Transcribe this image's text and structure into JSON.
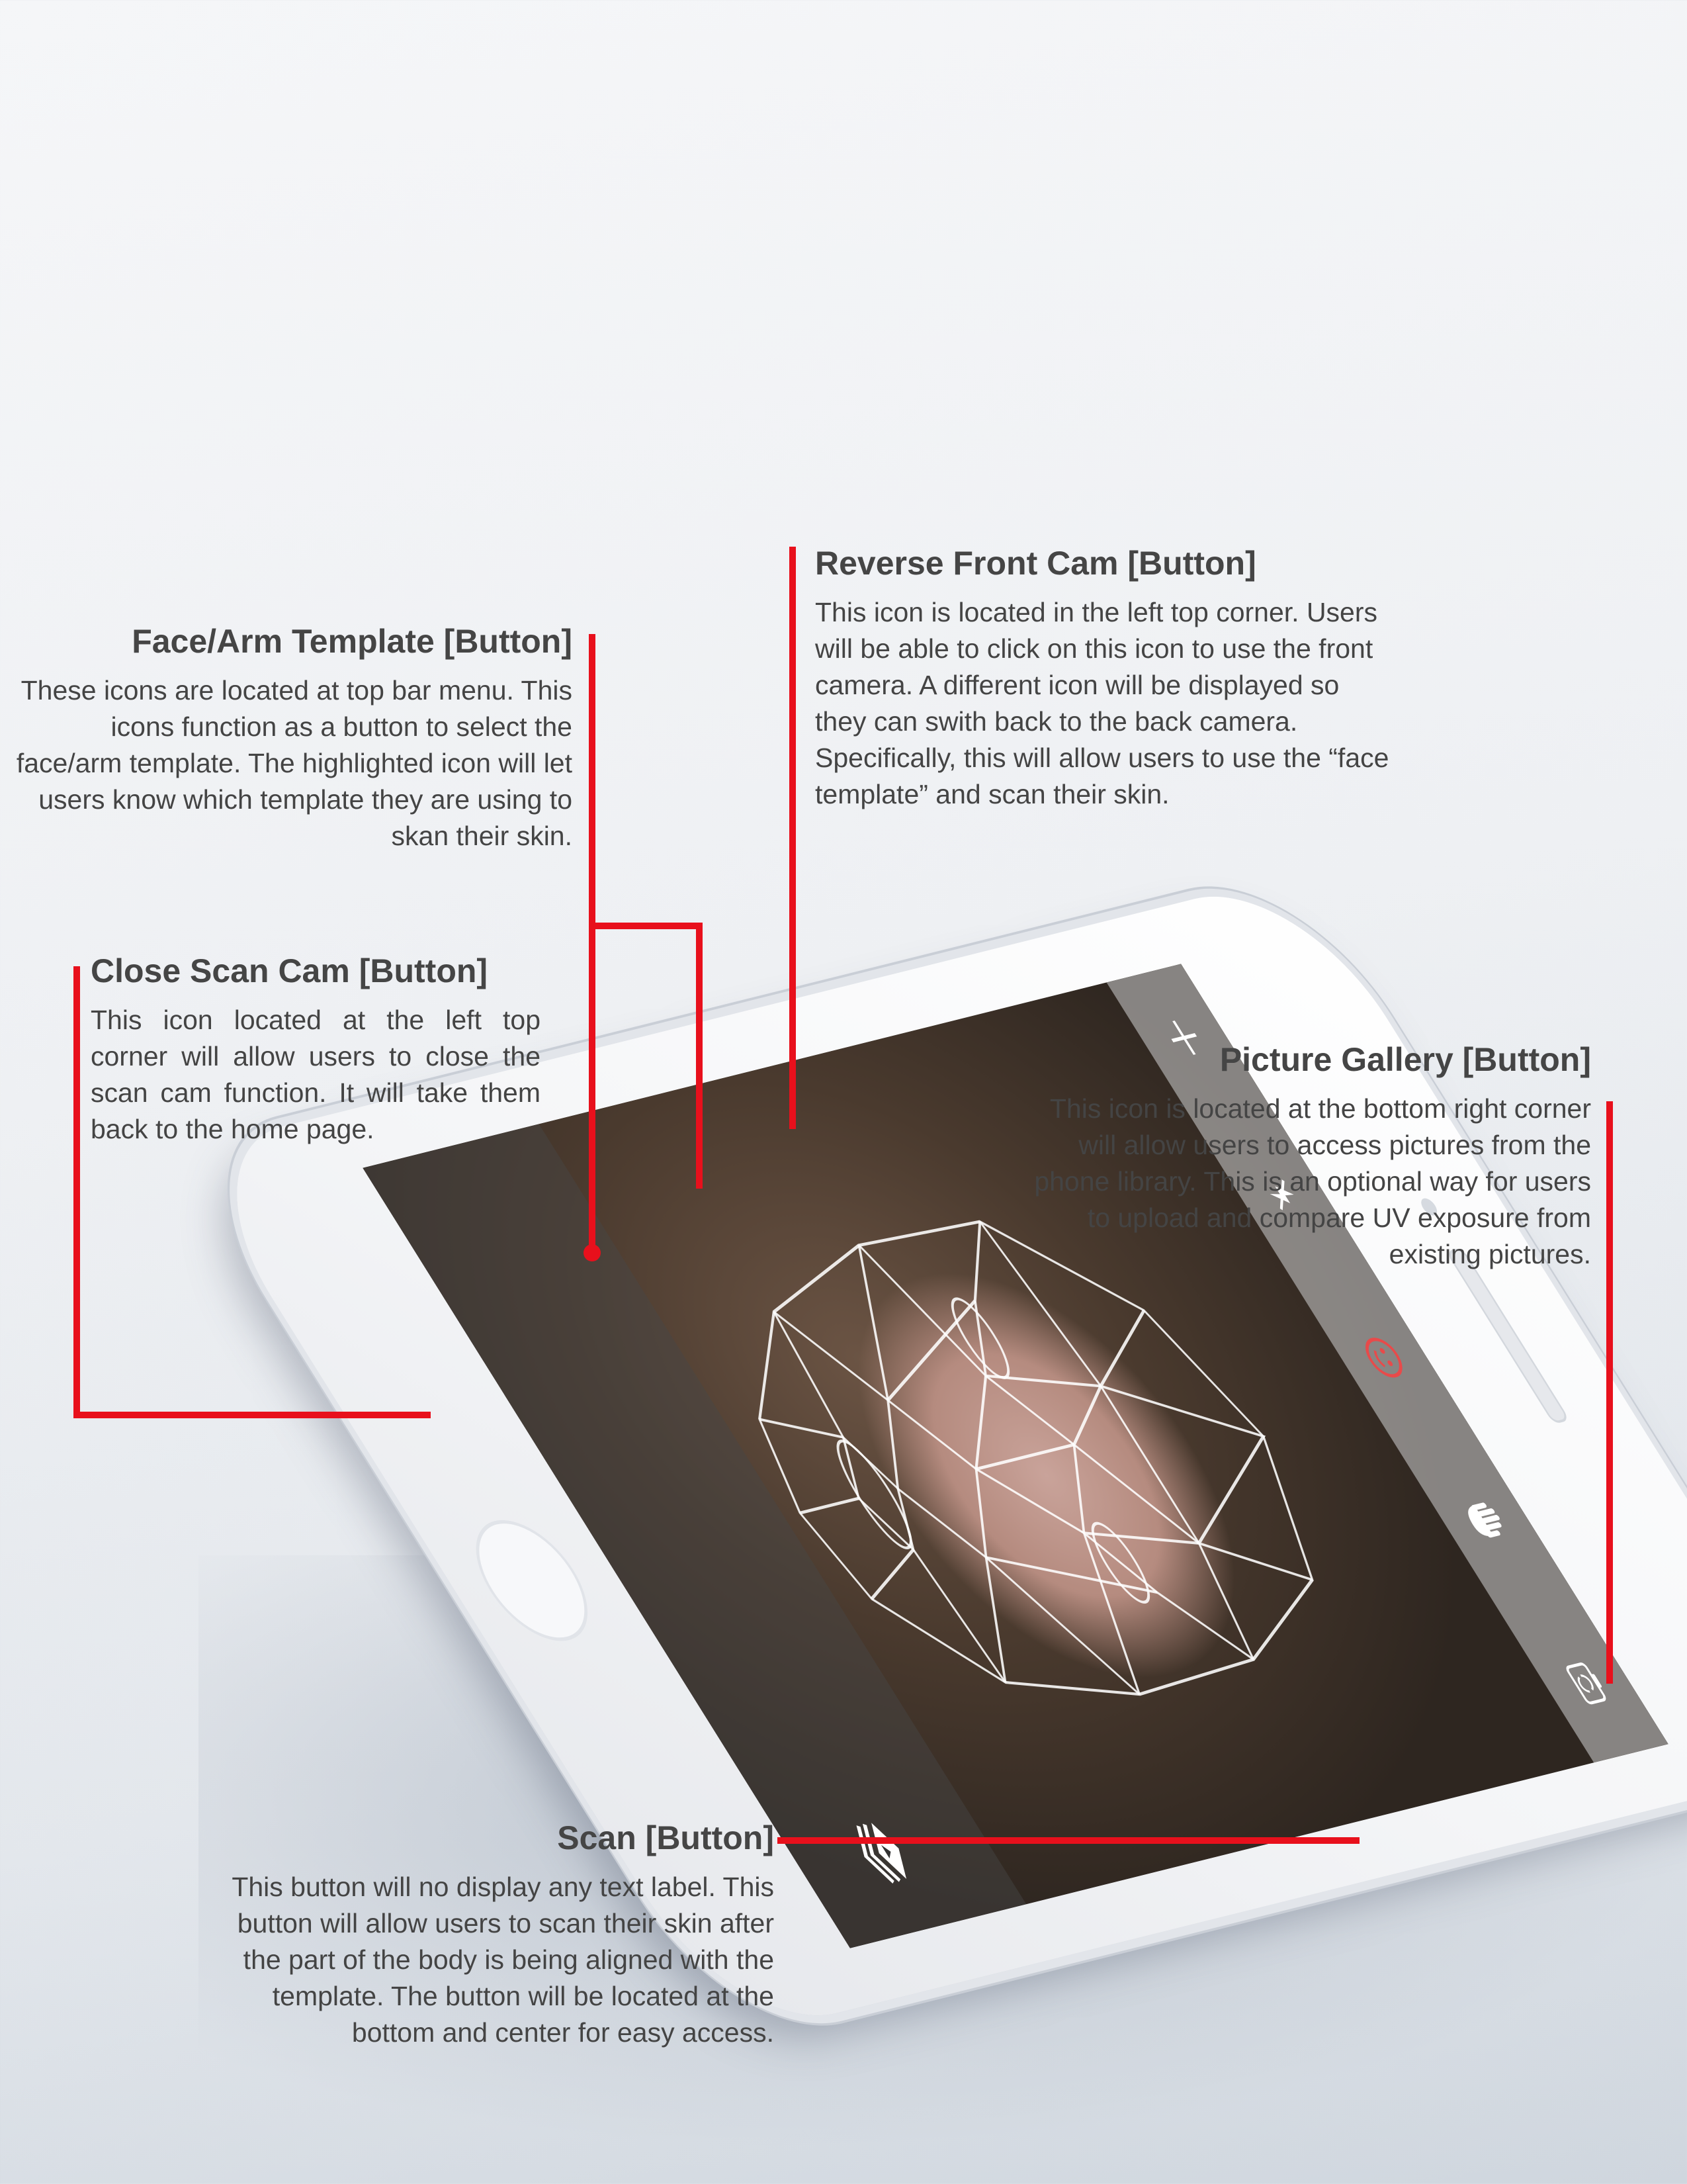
{
  "colors": {
    "leader_red": "#e8101c",
    "scan_button_fill": "#fde8b4",
    "scan_button_ring": "#1f1f1f",
    "face_icon_active": "#e84a4a",
    "mesh_line": "#ffffff"
  },
  "app_screen": {
    "top_bar_icons": [
      "close-icon",
      "flash-off-icon",
      "face-template-icon",
      "arm-template-icon",
      "reverse-camera-icon"
    ],
    "active_template": "face",
    "bottom_bar_icons": [
      "scan-button",
      "gallery-icon"
    ]
  },
  "callouts": {
    "face_arm": {
      "title": "Face/Arm Template [Button]",
      "body": "These icons are located at top bar menu. This icons function as a button to select the face/arm template. The highlighted icon will let users know which template they are using to skan their skin."
    },
    "reverse_cam": {
      "title": "Reverse Front Cam [Button]",
      "body": "This icon is located in the left top corner. Users will be able to click on this icon to use the front camera. A different icon will be displayed so they can swith back to the back camera. Specifically, this will allow users to use the “face template” and scan their skin."
    },
    "close_scan": {
      "title": "Close Scan Cam [Button]",
      "body": "This icon located at the left top corner will allow users to close the scan cam function. It will take them back to the home page."
    },
    "gallery": {
      "title": "Picture Gallery [Button]",
      "body": "This icon is located at the bottom right corner will allow users to access pictures from the phone library. This is an optional way for users to upload and compare UV exposure from existing pictures."
    },
    "scan": {
      "title": "Scan [Button]",
      "body": "This button will no display any text label. This button will allow users to scan their skin after the part of the body is being aligned with the template. The button will be located at the bottom and center for easy access."
    }
  }
}
